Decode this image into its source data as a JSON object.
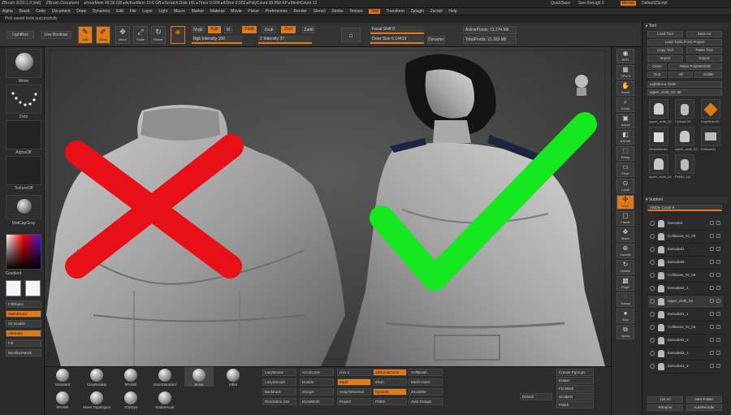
{
  "titlebar": {
    "items": [
      "ZBrush 2020.1.3 [mtt]",
      "ZBrush Document",
      "▸FreeMem 46.56 GB ▸ActiveMem 10.6 GB ▸Scratch Disk 141 ▸Timer 0.004 ▸ATime 0.002 ▸PolyCount 38.958 KP ▸MeshCount 12"
    ],
    "quicksave": "QuickSave",
    "see_through": "See-through 0",
    "menus_btn": "Menus",
    "script": "DefaultZScript"
  },
  "menubar": {
    "items": [
      "Alpha",
      "Brush",
      "Color",
      "Document",
      "Draw",
      "Dynamics",
      "Edit",
      "File",
      "Layer",
      "Light",
      "Macro",
      "Marker",
      "Material",
      "Movie",
      "Picker",
      "Preferences",
      "Render",
      "Stencil",
      "Stroke",
      "Texture",
      "Tool",
      "Transform",
      "Zplugin",
      "Zscript",
      "Help"
    ]
  },
  "noteline": "Pick saved tools successfully",
  "shelf": {
    "lightbox": "LightBox",
    "liveboolean": "Live Boolean",
    "buttons": [
      {
        "label": "Edit",
        "icon": "edit-icon",
        "active": true
      },
      {
        "label": "Draw",
        "icon": "draw-icon",
        "active": true
      },
      {
        "label": "Move",
        "icon": "move-icon",
        "active": false
      },
      {
        "label": "Scale",
        "icon": "scale-icon",
        "active": false
      },
      {
        "label": "Rotate",
        "icon": "rotate-icon",
        "active": false
      }
    ],
    "mrgb": "Mrgb",
    "rgb": "Rgb",
    "m": "M",
    "zadd": "Zadd",
    "zsub": "Zsub",
    "zcut": "Zcut",
    "rgb_intensity": "Rgb Intensity 100",
    "z_intensity": "Z Intensity 37",
    "focal_shift": "Focal Shift 0",
    "draw_size": "Draw Size 6.14419",
    "dynamic": "Dynamic",
    "active_points": "ActivePoints: 11.774 Mil",
    "total_points": "TotalPoints: 21.383 Mil"
  },
  "lefttray": {
    "thumbs": [
      "Move",
      "Dots",
      "AlphaOff",
      "TextureOff",
      "MatCapGray"
    ],
    "gradient": "Gradient",
    "switch_color": "SwitchColor",
    "alternate": "Alternate",
    "fill_object": "FillObject",
    "color1": "Color1",
    "color2": "Color2",
    "color_enable": "Clr Enable",
    "fill": "Fill",
    "backface": "BackfaceMask"
  },
  "viewport": {
    "wrong_mark": "cross-mark",
    "right_mark": "check-mark",
    "wrong_color": "#e80f16",
    "right_color": "#14e81f"
  },
  "rightstrip": {
    "items": [
      {
        "label": "BPR",
        "icon": "bpr-icon"
      },
      {
        "label": "SPix 3",
        "icon": "spix-icon"
      },
      {
        "label": "Scroll",
        "icon": "scroll-icon"
      },
      {
        "label": "Zoom",
        "icon": "zoom-icon"
      },
      {
        "label": "Actual",
        "icon": "actual-icon"
      },
      {
        "label": "AAHalf",
        "icon": "aahalf-icon"
      },
      {
        "label": "Persp",
        "icon": "persp-icon"
      },
      {
        "label": "Floor",
        "icon": "floor-icon"
      },
      {
        "label": "Local",
        "icon": "local-icon"
      },
      {
        "label": "XYZ",
        "icon": "xyz-icon"
      },
      {
        "label": "Frame",
        "icon": "frame-icon"
      },
      {
        "label": "Move",
        "icon": "move-icon"
      },
      {
        "label": "ZoomD",
        "icon": "zoom3d-icon"
      },
      {
        "label": "Rotate",
        "icon": "rotate-icon"
      },
      {
        "label": "PolyF",
        "icon": "polyf-icon"
      },
      {
        "label": "Transp",
        "icon": "transp-icon"
      },
      {
        "label": "Solo",
        "icon": "solo-icon"
      },
      {
        "label": "Xpose",
        "icon": "xpose-icon"
      }
    ]
  },
  "rightpanel": {
    "title": "Tool",
    "load_tool": "Load Tool",
    "save_as": "Save As",
    "copy_tool": "Copy Tool",
    "paste_tool": "Paste Tool",
    "import": "Import",
    "export": "Export",
    "clone": "Clone",
    "make_polymesh": "Make PolyMesh3D",
    "goz": "GoZ",
    "all": "All",
    "visible": "Visible",
    "lightbox_tools": "Lightbox ▸ Tools",
    "current_tool": "upper_cloth_02: 38",
    "tools": [
      "upper_cloth_02",
      "Cylinder3D",
      "PolyMesh3D",
      "SimpleBrush",
      "upper_cloth_03",
      "Extruded1",
      "upper_cloth_04",
      "PM3D_Cyl"
    ],
    "subtool_header": "Subtool",
    "visible_count": "Visible Count 9",
    "subtools": [
      "Extruded",
      "Collisions_02_09",
      "Extruded1",
      "Extruded3",
      "Collisions_02_05",
      "Extruded2_1",
      "upper_cloth_02",
      "Extruded1_1",
      "Collisions_02_06",
      "Extruded2_2",
      "Extruded3_1",
      "Extruded1_3"
    ],
    "list_all": "List All",
    "new_folder": "New Folder",
    "rename": "Rename",
    "autoreorder": "AutoReorder"
  },
  "bottomtray": {
    "brushes": [
      "Standard",
      "ClayBuildup",
      "hPolish",
      "DamStandard",
      "Move",
      "Inflat",
      "hPolish",
      "Move Topologica",
      "TrimDyn",
      "SnakeHook"
    ],
    "rows": [
      [
        "LazyMouse",
        "AccuCurve",
        "UVx 4",
        "ZeRomaCurve",
        "SoftBrush"
      ],
      [
        "LazySmooth",
        "Double",
        "Zadd",
        "ZSub",
        "Mesh Insert"
      ],
      [
        "Backtrack",
        "Groups",
        "SnapToNormal",
        "Dynamic",
        "Zmodeler"
      ],
      [
        "Resolution 416",
        "DynaMesh",
        "Project",
        "Polish",
        "Auto Groups"
      ]
    ],
    "right_block": [
      "Crease Pgroups",
      "Eraser",
      "Fix Mesh",
      "Sculptris",
      "Polish",
      "Detach"
    ]
  }
}
